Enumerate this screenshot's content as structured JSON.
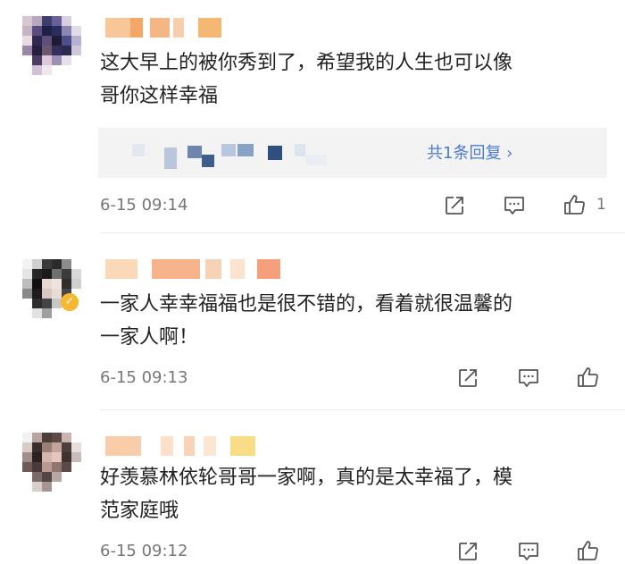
{
  "comments": [
    {
      "text": "这大早上的被你秀到了，希望我的人生也可以像\n哥你这样幸福",
      "time": "6-15 09:14",
      "reply_link": "共1条回复 ›",
      "like_count": "1"
    },
    {
      "text": "一家人幸幸福福也是很不错的，看着就很温馨的\n一家人啊！",
      "time": "6-15 09:13",
      "like_count": ""
    },
    {
      "text": "好羡慕林依轮哥哥一家啊，真的是太幸福了，模\n范家庭哦",
      "time": "6-15 09:12",
      "like_count": ""
    }
  ],
  "icons": {
    "share": "share-icon",
    "comment": "comment-icon",
    "like": "thumbs-up-icon",
    "verified": "verified-badge-icon"
  },
  "colors": {
    "link": "#4a7bd0",
    "meta": "#777777",
    "verified": "#f5b82e",
    "reply_bg": "#f3f3f3"
  }
}
